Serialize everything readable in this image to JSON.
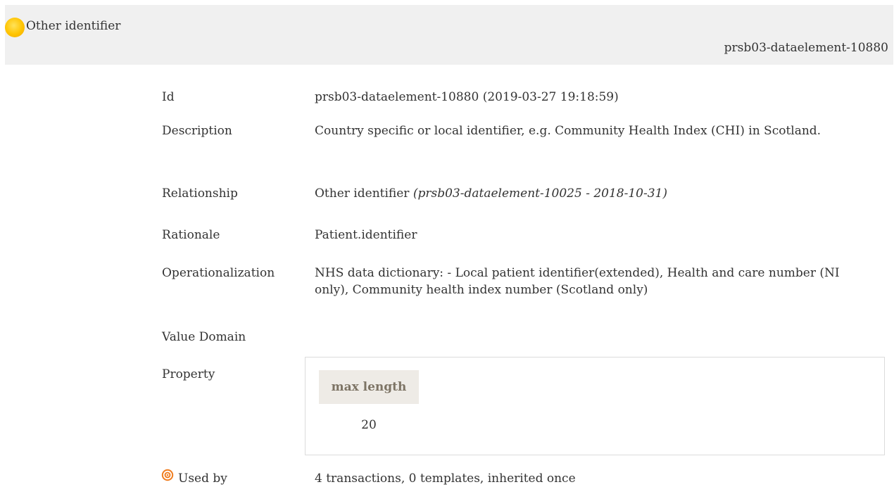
{
  "header": {
    "title": "Other identifier",
    "id": "prsb03-dataelement-10880",
    "status_icon": "yellow-circle-icon"
  },
  "rows": {
    "id": {
      "label": "Id",
      "value": "prsb03-dataelement-10880 (2019-03-27 19:18:59)"
    },
    "description": {
      "label": "Description",
      "value": "Country specific or local identifier, e.g. Community Health Index (CHI) in Scotland."
    },
    "relationship": {
      "label": "Relationship",
      "value_plain": "Other identifier ",
      "value_italic": "(prsb03-dataelement-10025 - 2018-10-31)"
    },
    "rationale": {
      "label": "Rationale",
      "value": "Patient.identifier"
    },
    "operationalization": {
      "label": "Operationalization",
      "value": "NHS data dictionary: - Local patient identifier(extended), Health and care number (NI only), Community health index number (Scotland only)"
    },
    "value_domain": {
      "label": "Value Domain"
    },
    "property": {
      "label": "Property",
      "column_header": "max length",
      "column_value": "20"
    },
    "used_by": {
      "icon": "target-icon",
      "label": "Used by",
      "value": "4 transactions, 0 templates, inherited once"
    }
  },
  "colors": {
    "header_bg": "#f0f0f0",
    "status_yellow": "#ffc400",
    "used_by_orange": "#f07c1e",
    "property_header_bg": "#eeebe6",
    "property_header_text": "#7d7465"
  }
}
